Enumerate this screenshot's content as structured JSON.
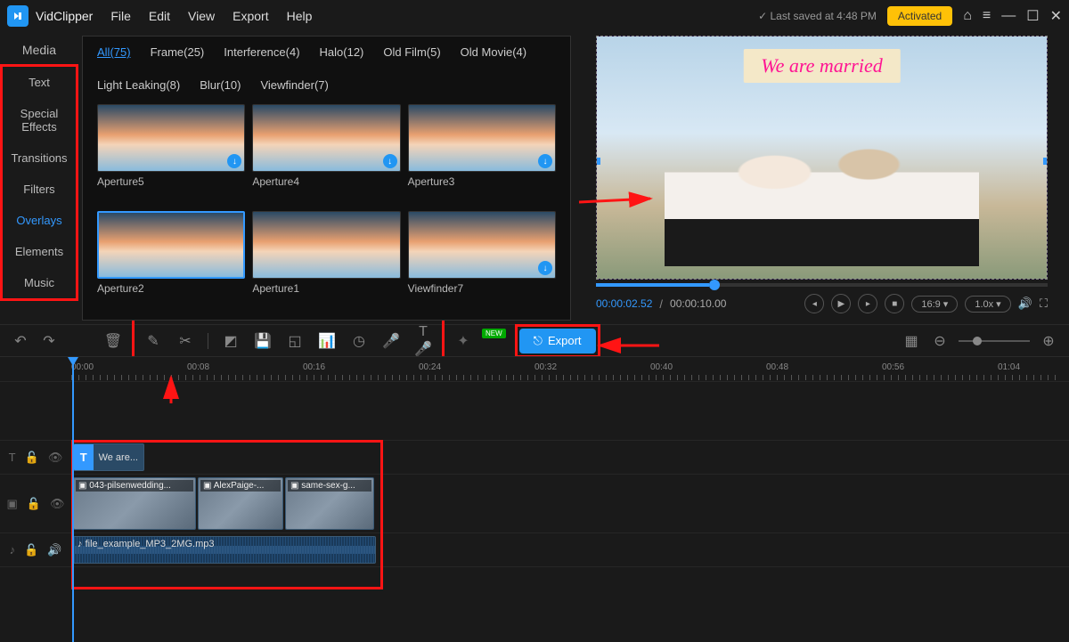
{
  "app": {
    "name": "VidClipper"
  },
  "menu": [
    "File",
    "Edit",
    "View",
    "Export",
    "Help"
  ],
  "titlebar": {
    "saved": "Last saved at 4:48 PM",
    "activated": "Activated"
  },
  "sidebar": {
    "header": "Media",
    "items": [
      "Text",
      "Special Effects",
      "Transitions",
      "Filters",
      "Overlays",
      "Elements",
      "Music"
    ],
    "active_index": 4
  },
  "gallery": {
    "tabs": [
      {
        "label": "All(75)",
        "active": true
      },
      {
        "label": "Frame(25)"
      },
      {
        "label": "Interference(4)"
      },
      {
        "label": "Halo(12)"
      },
      {
        "label": "Old Film(5)"
      },
      {
        "label": "Old Movie(4)"
      },
      {
        "label": "Light Leaking(8)"
      },
      {
        "label": "Blur(10)"
      },
      {
        "label": "Viewfinder(7)"
      }
    ],
    "items": [
      {
        "label": "Aperture5"
      },
      {
        "label": "Aperture4"
      },
      {
        "label": "Aperture3"
      },
      {
        "label": "Aperture2",
        "selected": true
      },
      {
        "label": "Aperture1"
      },
      {
        "label": "Viewfinder7"
      }
    ]
  },
  "preview": {
    "banner_text": "We are married",
    "time_current": "00:00:02.52",
    "time_total": "00:00:10.00",
    "aspect": "16:9",
    "speed": "1.0x"
  },
  "toolbar": {
    "new_badge": "NEW",
    "export_label": "Export"
  },
  "ruler": {
    "ticks": [
      "00:00",
      "00:08",
      "00:16",
      "00:24",
      "00:32",
      "00:40",
      "00:48",
      "00:56",
      "01:04"
    ]
  },
  "tracks": {
    "text_clip": "We are...",
    "video_clips": [
      {
        "label": "043-pilsenwedding..."
      },
      {
        "label": "AlexPaige-..."
      },
      {
        "label": "same-sex-g..."
      }
    ],
    "audio_clip": "file_example_MP3_2MG.mp3"
  }
}
